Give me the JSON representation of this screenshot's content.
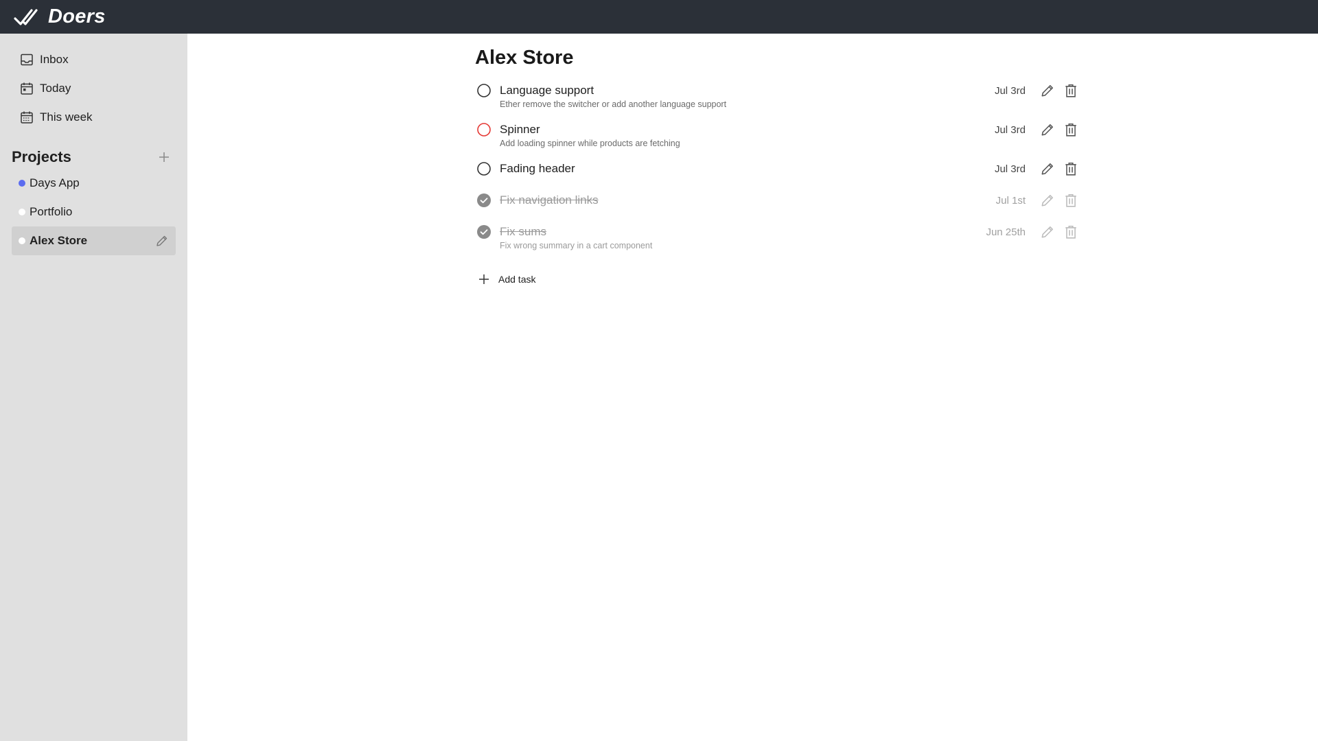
{
  "app": {
    "name": "Doers"
  },
  "sidebar": {
    "nav": [
      {
        "label": "Inbox",
        "icon": "inbox-icon"
      },
      {
        "label": "Today",
        "icon": "calendar-today-icon"
      },
      {
        "label": "This week",
        "icon": "calendar-week-icon"
      }
    ],
    "projects_title": "Projects",
    "projects": [
      {
        "label": "Days App",
        "color": "#5b6cf0",
        "active": false
      },
      {
        "label": "Portfolio",
        "color": "#ffffff",
        "active": false
      },
      {
        "label": "Alex Store",
        "color": "#ffffff",
        "active": true
      }
    ]
  },
  "main": {
    "title": "Alex Store",
    "tasks": [
      {
        "title": "Language support",
        "description": "Ether remove the switcher or add another language support",
        "date": "Jul 3rd",
        "done": false,
        "priority_color": "#333333"
      },
      {
        "title": "Spinner",
        "description": "Add loading spinner while products are fetching",
        "date": "Jul 3rd",
        "done": false,
        "priority_color": "#e53935"
      },
      {
        "title": "Fading header",
        "description": "",
        "date": "Jul 3rd",
        "done": false,
        "priority_color": "#333333"
      },
      {
        "title": "Fix navigation links",
        "description": "",
        "date": "Jul 1st",
        "done": true,
        "priority_color": "#8a8a8a"
      },
      {
        "title": "Fix sums",
        "description": "Fix wrong summary in a cart component",
        "date": "Jun 25th",
        "done": true,
        "priority_color": "#8a8a8a"
      }
    ],
    "add_task_label": "Add task"
  }
}
